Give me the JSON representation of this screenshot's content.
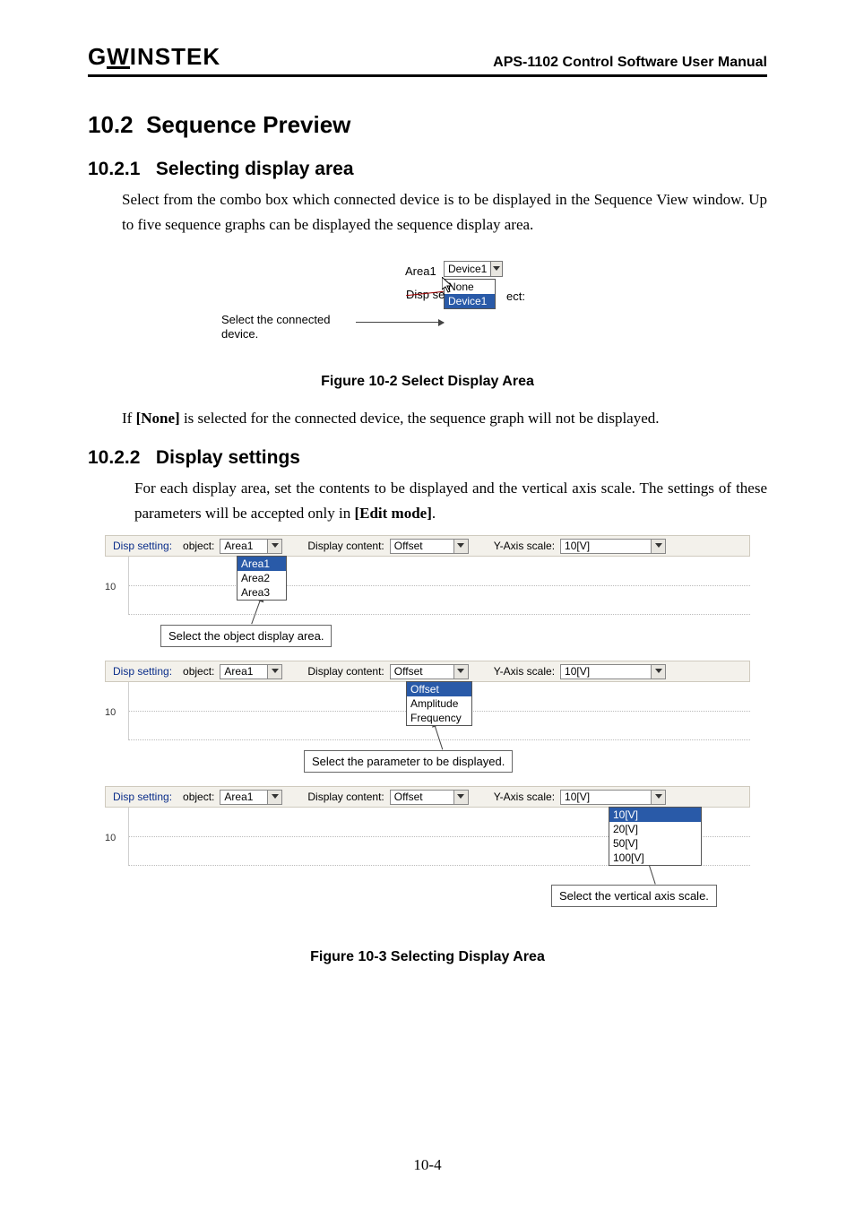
{
  "header": {
    "logo": "GWINSTEK",
    "manual": "APS-1102 Control Software User Manual"
  },
  "section": {
    "num": "10.2",
    "title": "Sequence Preview"
  },
  "s1": {
    "num": "10.2.1",
    "title": "Selecting display area",
    "para": "Select from the combo box which connected device is to be displayed in the Sequence View window. Up to five sequence graphs can be displayed the sequence display area."
  },
  "fig102": {
    "area_label": "Area1",
    "combo_value": "Device1",
    "options": [
      "None",
      "Device1"
    ],
    "selected": "Device1",
    "dispse": "Disp se",
    "ect": "ect:",
    "callout": "Select the connected device.",
    "caption": "Figure 10-2  Select Display Area"
  },
  "note1_pre": "If ",
  "note1_bold": "[None]",
  "note1_post": " is selected for the connected device, the sequence graph will not be displayed.",
  "s2": {
    "num": "10.2.2",
    "title": "Display settings",
    "para_pre": "For each display area, set the contents to be displayed and the vertical axis scale. The settings of these parameters will be accepted only in ",
    "para_bold": "[Edit mode]",
    "para_post": "."
  },
  "fig103": {
    "rowlabels": {
      "disp": "Disp setting:",
      "object": "object:",
      "dispcontent": "Display content:",
      "yaxis": "Y-Axis scale:"
    },
    "row_object_value": "Area1",
    "row_content_value": "Offset",
    "row_yaxis_value": "10[V]",
    "ytick": "10",
    "obj_options": [
      "Area1",
      "Area2",
      "Area3"
    ],
    "obj_selected": "Area1",
    "obj_callout": "Select the object display area.",
    "content_options": [
      "Offset",
      "Amplitude",
      "Frequency"
    ],
    "content_selected": "Offset",
    "content_callout": "Select the parameter to be displayed.",
    "yaxis_options": [
      "10[V]",
      "20[V]",
      "50[V]",
      "100[V]"
    ],
    "yaxis_selected": "10[V]",
    "yaxis_callout": "Select the vertical axis scale.",
    "caption": "Figure 10-3 Selecting Display Area"
  },
  "page_no": "10-4"
}
